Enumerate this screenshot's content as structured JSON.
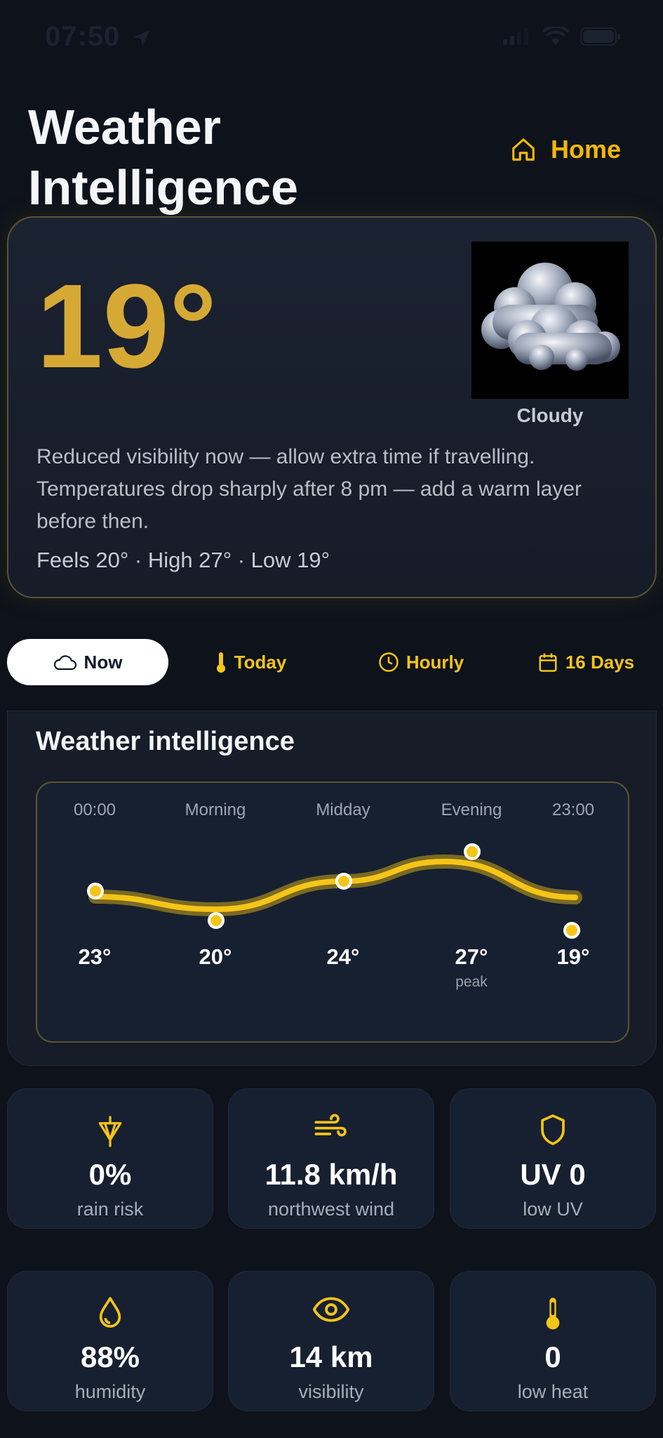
{
  "status_bar": {
    "time": "07:50"
  },
  "header": {
    "title": "Weather Intelligence",
    "home_label": "Home"
  },
  "hero": {
    "temperature": "19°",
    "condition": "Cloudy",
    "advice": "Reduced visibility now — allow extra time if travelling. Temperatures drop sharply after 8 pm — add a warm layer before then.",
    "summary": "Feels 20° · High 27° · Low 19°"
  },
  "tabs": [
    {
      "label": "Now",
      "icon": "cloud-icon",
      "active": true
    },
    {
      "label": "Today",
      "icon": "thermometer-icon"
    },
    {
      "label": "Hourly",
      "icon": "clock-icon"
    },
    {
      "label": "16 Days",
      "icon": "calendar-icon"
    }
  ],
  "intel": {
    "title": "Weather intelligence",
    "chart_data": {
      "type": "line",
      "categories": [
        "00:00",
        "Morning",
        "Midday",
        "Evening",
        "23:00"
      ],
      "values": [
        23,
        20,
        24,
        27,
        19
      ],
      "value_labels": [
        "23°",
        "20°",
        "24°",
        "27°",
        "19°"
      ],
      "peak_label": "peak",
      "peak_index": 3
    }
  },
  "stats": [
    {
      "icon": "umbrella-icon",
      "value": "0%",
      "label": "rain risk"
    },
    {
      "icon": "wind-icon",
      "value": "11.8 km/h",
      "label": "northwest wind"
    },
    {
      "icon": "shield-icon",
      "value": "UV 0",
      "label": "low UV"
    },
    {
      "icon": "droplet-icon",
      "value": "88%",
      "label": "humidity"
    },
    {
      "icon": "eye-icon",
      "value": "14 km",
      "label": "visibility"
    },
    {
      "icon": "thermometer-icon",
      "value": "0",
      "label": "low heat"
    }
  ],
  "colors": {
    "accent": "#f5c518",
    "temp": "#d6a935",
    "background": "#0d121b",
    "card": "#172030"
  }
}
